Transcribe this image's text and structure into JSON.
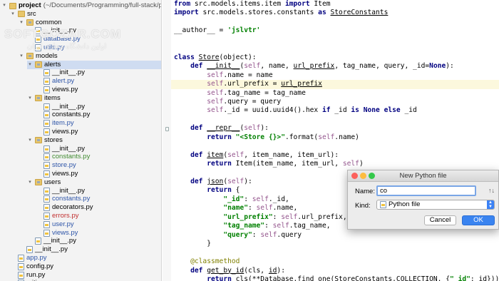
{
  "tree": {
    "rows": [
      {
        "label": "project",
        "suffix": " (~/Documents/Programming/full-stack/price_o",
        "indent": 0,
        "kind": "folder",
        "arrow": "▾",
        "color": "black",
        "bold": true
      },
      {
        "label": "src",
        "indent": 1,
        "kind": "folder",
        "arrow": "▾",
        "color": "black"
      },
      {
        "label": "common",
        "indent": 2,
        "kind": "pkg",
        "arrow": "▾",
        "color": "black"
      },
      {
        "label": "__init__.py",
        "indent": 3,
        "kind": "py",
        "color": "black"
      },
      {
        "label": "database.py",
        "indent": 3,
        "kind": "py",
        "color": "blue"
      },
      {
        "label": "utils.py",
        "indent": 3,
        "kind": "py",
        "color": "blue"
      },
      {
        "label": "models",
        "indent": 2,
        "kind": "pkg",
        "arrow": "▾",
        "color": "black"
      },
      {
        "label": "alerts",
        "indent": 3,
        "kind": "pkg",
        "arrow": "▾",
        "color": "black",
        "selected": true
      },
      {
        "label": "__init__.py",
        "indent": 4,
        "kind": "py",
        "color": "black"
      },
      {
        "label": "alert.py",
        "indent": 4,
        "kind": "py",
        "color": "blue"
      },
      {
        "label": "views.py",
        "indent": 4,
        "kind": "py",
        "color": "black"
      },
      {
        "label": "items",
        "indent": 3,
        "kind": "pkg",
        "arrow": "▾",
        "color": "black"
      },
      {
        "label": "__init__.py",
        "indent": 4,
        "kind": "py",
        "color": "black"
      },
      {
        "label": "constants.py",
        "indent": 4,
        "kind": "py",
        "color": "black"
      },
      {
        "label": "item.py",
        "indent": 4,
        "kind": "py",
        "color": "blue"
      },
      {
        "label": "views.py",
        "indent": 4,
        "kind": "py",
        "color": "black"
      },
      {
        "label": "stores",
        "indent": 3,
        "kind": "pkg",
        "arrow": "▾",
        "color": "black"
      },
      {
        "label": "__init__.py",
        "indent": 4,
        "kind": "py",
        "color": "black"
      },
      {
        "label": "constants.py",
        "indent": 4,
        "kind": "py",
        "color": "green"
      },
      {
        "label": "store.py",
        "indent": 4,
        "kind": "py",
        "color": "blue"
      },
      {
        "label": "views.py",
        "indent": 4,
        "kind": "py",
        "color": "black"
      },
      {
        "label": "users",
        "indent": 3,
        "kind": "pkg",
        "arrow": "▾",
        "color": "black"
      },
      {
        "label": "__init__.py",
        "indent": 4,
        "kind": "py",
        "color": "black"
      },
      {
        "label": "constants.py",
        "indent": 4,
        "kind": "py",
        "color": "blue"
      },
      {
        "label": "decorators.py",
        "indent": 4,
        "kind": "py",
        "color": "black"
      },
      {
        "label": "errors.py",
        "indent": 4,
        "kind": "py",
        "color": "red"
      },
      {
        "label": "user.py",
        "indent": 4,
        "kind": "py",
        "color": "blue"
      },
      {
        "label": "views.py",
        "indent": 4,
        "kind": "py",
        "color": "blue"
      },
      {
        "label": "__init__.py",
        "indent": 3,
        "kind": "py",
        "color": "black"
      },
      {
        "label": "__init__.py",
        "indent": 2,
        "kind": "py",
        "color": "black"
      },
      {
        "label": "app.py",
        "indent": 1,
        "kind": "py",
        "color": "blue"
      },
      {
        "label": "config.py",
        "indent": 1,
        "kind": "py",
        "color": "black"
      },
      {
        "label": "run.py",
        "indent": 1,
        "kind": "py",
        "color": "black"
      },
      {
        "label": ".gitignore",
        "indent": 1,
        "kind": "py",
        "color": "black"
      }
    ],
    "watermark": "SOFTGOZAR.COM",
    "watermark_sub": "اولین دانشگاه مجازی ایران"
  },
  "code": {
    "lines": [
      [
        [
          "from ",
          "kw"
        ],
        [
          "src.models.items.item ",
          ""
        ],
        [
          "import ",
          "kw"
        ],
        [
          "Item",
          ""
        ]
      ],
      [
        [
          "import ",
          "kw"
        ],
        [
          "src.models.stores.constants ",
          ""
        ],
        [
          "as ",
          "kw"
        ],
        [
          "StoreConstants",
          "ul"
        ]
      ],
      [],
      [
        [
          "__author__ = ",
          ""
        ],
        [
          "'jslvtr'",
          "str"
        ]
      ],
      [],
      [],
      [
        [
          "class ",
          "kw"
        ],
        [
          "Store",
          "ul"
        ],
        [
          "(object):",
          ""
        ]
      ],
      [
        [
          "    ",
          ""
        ],
        [
          "def ",
          "kw"
        ],
        [
          "__init__",
          "ul"
        ],
        [
          "(",
          ""
        ],
        [
          "self",
          "self"
        ],
        [
          ", name, ",
          ""
        ],
        [
          "url_prefix",
          "ul"
        ],
        [
          ", tag_name, query, _id=",
          ""
        ],
        [
          "None",
          "kw"
        ],
        [
          "):",
          ""
        ]
      ],
      [
        [
          "        ",
          ""
        ],
        [
          "self",
          "self"
        ],
        [
          ".name = name",
          ""
        ]
      ],
      [
        [
          "        ",
          ""
        ],
        [
          "self",
          "self"
        ],
        [
          ".url_prefix = ",
          ""
        ],
        [
          "url_prefix",
          "ul"
        ]
      ],
      [
        [
          "        ",
          ""
        ],
        [
          "self",
          "self"
        ],
        [
          ".tag_name = tag_name",
          ""
        ]
      ],
      [
        [
          "        ",
          ""
        ],
        [
          "self",
          "self"
        ],
        [
          ".query = query",
          ""
        ]
      ],
      [
        [
          "        ",
          ""
        ],
        [
          "self",
          "self"
        ],
        [
          "._id = uuid.uuid4().hex ",
          ""
        ],
        [
          "if ",
          "kw"
        ],
        [
          "_id ",
          ""
        ],
        [
          "is None else ",
          "kw"
        ],
        [
          "_id",
          ""
        ]
      ],
      [],
      [
        [
          "    ",
          ""
        ],
        [
          "def ",
          "kw"
        ],
        [
          "__repr__",
          "ul"
        ],
        [
          "(",
          ""
        ],
        [
          "self",
          "self"
        ],
        [
          "):",
          ""
        ]
      ],
      [
        [
          "        ",
          ""
        ],
        [
          "return ",
          "kw"
        ],
        [
          "\"<Store {}>\"",
          "str"
        ],
        [
          ".format(",
          ""
        ],
        [
          "self",
          "self"
        ],
        [
          ".name)",
          ""
        ]
      ],
      [],
      [
        [
          "    ",
          ""
        ],
        [
          "def ",
          "kw"
        ],
        [
          "item",
          "ul"
        ],
        [
          "(",
          ""
        ],
        [
          "self",
          "self"
        ],
        [
          ", item_name, item_url):",
          ""
        ]
      ],
      [
        [
          "        ",
          ""
        ],
        [
          "return ",
          "kw"
        ],
        [
          "Item(item_name, item_url, ",
          ""
        ],
        [
          "self",
          "self"
        ],
        [
          ")",
          ""
        ]
      ],
      [],
      [
        [
          "    ",
          ""
        ],
        [
          "def ",
          "kw"
        ],
        [
          "json",
          "ul"
        ],
        [
          "(",
          ""
        ],
        [
          "self",
          "self"
        ],
        [
          "):",
          ""
        ]
      ],
      [
        [
          "        ",
          ""
        ],
        [
          "return ",
          "kw"
        ],
        [
          "{",
          ""
        ]
      ],
      [
        [
          "            ",
          ""
        ],
        [
          "\"_id\"",
          "str"
        ],
        [
          ": ",
          ""
        ],
        [
          "self",
          "self"
        ],
        [
          "._id,",
          ""
        ]
      ],
      [
        [
          "            ",
          ""
        ],
        [
          "\"name\"",
          "str"
        ],
        [
          ": ",
          ""
        ],
        [
          "self",
          "self"
        ],
        [
          ".name,",
          ""
        ]
      ],
      [
        [
          "            ",
          ""
        ],
        [
          "\"url_prefix\"",
          "str"
        ],
        [
          ": ",
          ""
        ],
        [
          "self",
          "self"
        ],
        [
          ".url_prefix,",
          ""
        ]
      ],
      [
        [
          "            ",
          ""
        ],
        [
          "\"tag_name\"",
          "str"
        ],
        [
          ": ",
          ""
        ],
        [
          "self",
          "self"
        ],
        [
          ".tag_name,",
          ""
        ]
      ],
      [
        [
          "            ",
          ""
        ],
        [
          "\"query\"",
          "str"
        ],
        [
          ": ",
          ""
        ],
        [
          "self",
          "self"
        ],
        [
          ".query",
          ""
        ]
      ],
      [
        [
          "        }",
          ""
        ]
      ],
      [],
      [
        [
          "    ",
          ""
        ],
        [
          "@classmethod",
          "dec"
        ]
      ],
      [
        [
          "    ",
          ""
        ],
        [
          "def ",
          "kw"
        ],
        [
          "get_by_id",
          "ul"
        ],
        [
          "(cls, ",
          ""
        ],
        [
          "id",
          "ul"
        ],
        [
          "):",
          ""
        ]
      ],
      [
        [
          "        ",
          ""
        ],
        [
          "return ",
          "kw"
        ],
        [
          "cls(**Database.find_one(StoreConstants.COLLECTION, {",
          ""
        ],
        [
          "\"_id\"",
          "str"
        ],
        [
          ": id}))",
          ""
        ]
      ]
    ]
  },
  "dialog": {
    "title": "New Python file",
    "name_label": "Name:",
    "name_value": "co",
    "kind_label": "Kind:",
    "kind_value": "Python file",
    "cancel_label": "Cancel",
    "ok_label": "OK",
    "colors": {
      "close": "#fc605c",
      "min": "#fdbc40",
      "max": "#34c84a",
      "ok": "#3a84f0"
    }
  }
}
